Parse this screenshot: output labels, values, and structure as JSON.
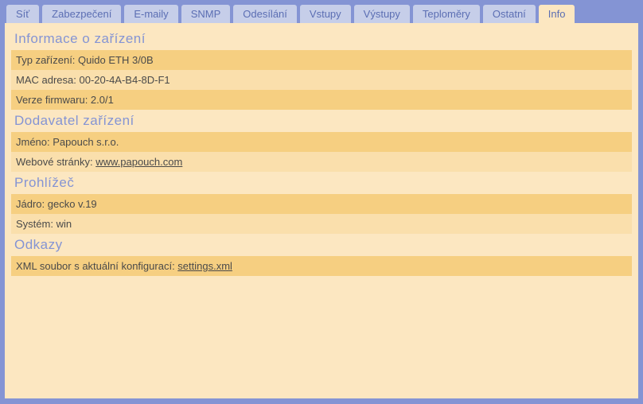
{
  "tabs": [
    {
      "label": "Síť"
    },
    {
      "label": "Zabezpečení"
    },
    {
      "label": "E-maily"
    },
    {
      "label": "SNMP"
    },
    {
      "label": "Odesílání"
    },
    {
      "label": "Vstupy"
    },
    {
      "label": "Výstupy"
    },
    {
      "label": "Teploměry"
    },
    {
      "label": "Ostatní"
    },
    {
      "label": "Info",
      "active": true
    }
  ],
  "sections": {
    "device_info": {
      "title": "Informace o zařízení",
      "type_label": "Typ zařízení: ",
      "type_value": "Quido ETH 3/0B",
      "mac_label": "MAC adresa: ",
      "mac_value": "00-20-4A-B4-8D-F1",
      "fw_label": "Verze firmwaru: ",
      "fw_value": "2.0/1"
    },
    "supplier": {
      "title": "Dodavatel zařízení",
      "name_label": "Jméno: ",
      "name_value": "Papouch s.r.o.",
      "web_label": "Webové stránky: ",
      "web_link": "www.papouch.com"
    },
    "browser": {
      "title": "Prohlížeč",
      "engine_label": "Jádro: ",
      "engine_value": "gecko v.19",
      "system_label": "Systém: ",
      "system_value": "win"
    },
    "links": {
      "title": "Odkazy",
      "xml_label": "XML soubor s aktuální konfigurací: ",
      "xml_link": "settings.xml"
    }
  }
}
